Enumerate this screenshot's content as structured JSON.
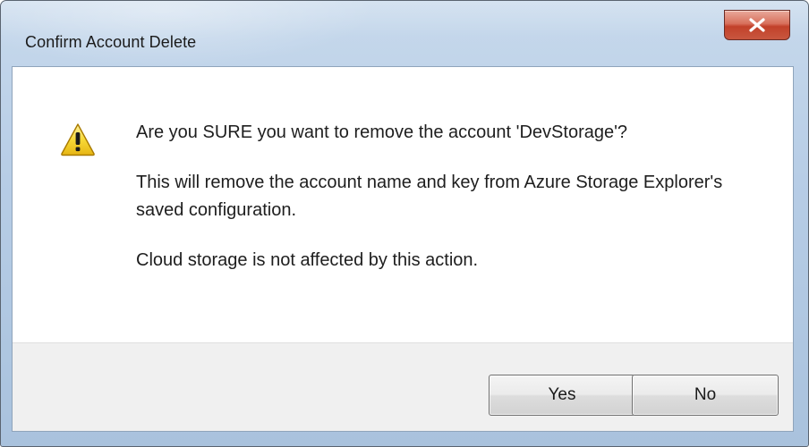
{
  "window": {
    "title": "Confirm Account Delete",
    "close_icon": "close-x-icon"
  },
  "dialog": {
    "icon": "warning-icon",
    "message_main": "Are you SURE you want to remove the account 'DevStorage'?",
    "message_detail": "This will remove the account name and key from Azure Storage Explorer's saved configuration.",
    "message_note": "Cloud storage is not affected by this action."
  },
  "buttons": {
    "yes_label": "Yes",
    "no_label": "No"
  },
  "colors": {
    "close_button": "#c7442d",
    "warning_fill": "#f5d02a",
    "frame": "#b7cde6",
    "footer": "#f0f0f0"
  }
}
